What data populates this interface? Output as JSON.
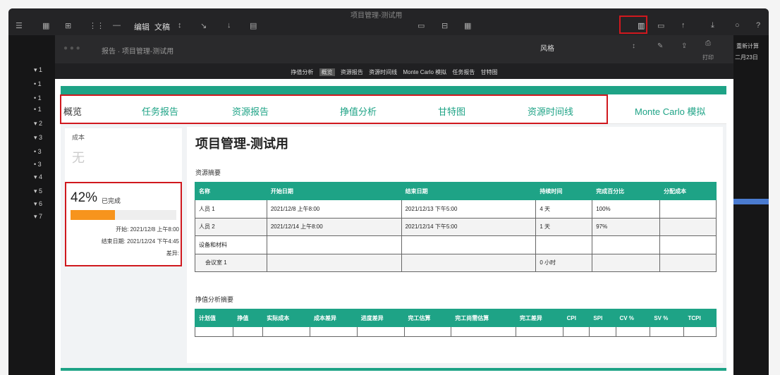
{
  "window": {
    "title": "项目管理-测试用"
  },
  "toolbar": {
    "edit_label": "编辑",
    "text_label": "文稿"
  },
  "inner_header": {
    "breadcrumb": "报告 · 项目管理-测试用",
    "style_label": "风格",
    "right_label": "打印"
  },
  "report_strip": [
    "挣值分析",
    "概览",
    "资源报告",
    "资源时间线",
    "Monte Carlo 模拟",
    "任务报告",
    "甘特图"
  ],
  "report_strip_selected": 1,
  "right_sidebar": {
    "label": "重新计算",
    "date": "二月23日"
  },
  "nav_tabs": [
    "概览",
    "任务报告",
    "资源报告",
    "挣值分析",
    "甘特图",
    "资源时间线",
    "Monte Carlo 模拟"
  ],
  "left_card": {
    "cost_label": "成本",
    "cost_value": "无",
    "percent": "42%",
    "percent_suffix": "已完成",
    "progress": 0.42,
    "start_label": "开始:",
    "start_value": "2021/12/8 上午8:00",
    "end_label": "结束日期:",
    "end_value": "2021/12/24 下午4:45",
    "diff_label": "差异:"
  },
  "main": {
    "title": "项目管理-测试用",
    "resource_section": "资源摘要",
    "ev_section": "挣值分析摘要"
  },
  "resource_table": {
    "headers": [
      "名称",
      "开始日期",
      "结束日期",
      "持续时间",
      "完成百分比",
      "分配成本"
    ],
    "rows": [
      [
        "人员 1",
        "2021/12/8 上午8:00",
        "2021/12/13 下午5:00",
        "4 天",
        "100%",
        ""
      ],
      [
        "人员 2",
        "2021/12/14 上午8:00",
        "2021/12/14 下午5:00",
        "1 天",
        "97%",
        ""
      ],
      [
        "设备和材料",
        "",
        "",
        "",
        "",
        ""
      ],
      [
        "  会议室 1",
        "",
        "",
        "0 小时",
        "",
        ""
      ]
    ]
  },
  "ev_table": {
    "headers": [
      "计划值",
      "挣值",
      "实际成本",
      "成本差异",
      "进度差异",
      "完工估算",
      "完工尚需估算",
      "完工差异",
      "CPI",
      "SPI",
      "CV %",
      "SV %",
      "TCPI"
    ]
  },
  "colors": {
    "accent": "#1ea386",
    "progress": "#f7941d",
    "highlight": "#d0181e"
  }
}
